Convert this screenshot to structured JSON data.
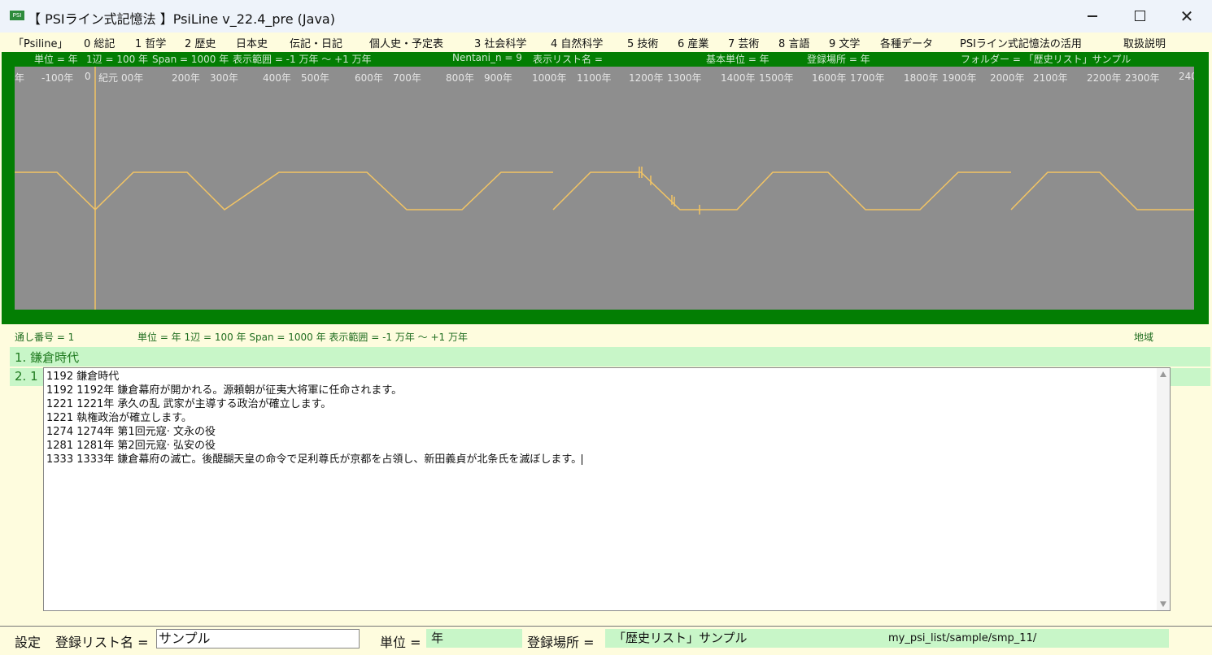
{
  "window": {
    "icon_text": "PSI",
    "title": "【 PSIライン式記憶法 】PsiLine v_22.4_pre (Java)"
  },
  "menu": [
    "「Psiline」",
    "0 総記",
    "1 哲学",
    "2 歴史",
    "日本史",
    "伝記・日記",
    "個人史・予定表",
    "3 社会科学",
    "4 自然科学",
    "5 技術",
    "6 産業",
    "7 芸術",
    "8 言語",
    "9 文学",
    "各種データ",
    "PSIライン式記憶法の活用",
    "取扱説明"
  ],
  "timeline": {
    "info": {
      "unit": "単位 = 年",
      "side": "1辺 = 100 年",
      "span": "Span = 1000 年",
      "range": "表示範囲 = -1 万年 〜 +1 万年",
      "nentani": "Nentani_n = 9",
      "list_name": "表示リスト名 =",
      "base_unit": "基本単位 = 年",
      "location": "登録場所 = 年",
      "folder": "フォルダー = 「歴史リスト」サンプル"
    },
    "ticks": [
      "年",
      "-100年",
      "0",
      "紀元",
      "00年",
      "200年",
      "300年",
      "400年",
      "500年",
      "600年",
      "700年",
      "800年",
      "900年",
      "1000年",
      "1100年",
      "1200年",
      "1300年",
      "1400年",
      "1500年",
      "1600年",
      "1700年",
      "1800年",
      "1900年",
      "2000年",
      "2100年",
      "2200年",
      "2300年",
      "240"
    ],
    "line_color": "#f2c464",
    "background_color": "#8e8e8e",
    "frame_color": "#037e03"
  },
  "status": {
    "serial": "通し番号 = 1",
    "detail": "単位 = 年  1辺 = 100 年  Span = 1000 年  表示範囲 = -1 万年 〜 +1 万年",
    "region": "地域"
  },
  "list": {
    "item1": "1. 鎌倉時代",
    "item2": "2. 1"
  },
  "editor": {
    "lines": [
      "1192  鎌倉時代",
      "1192  1192年 鎌倉幕府が開かれる。源頼朝が征夷大将軍に任命されます。",
      "1221  1221年 承久の乱 武家が主導する政治が確立します。",
      "1221  執権政治が確立します。",
      "1274  1274年 第1回元寇· 文永の役",
      "1281  1281年 第2回元寇· 弘安の役",
      "1333  1333年 鎌倉幕府の滅亡。後醍醐天皇の命令で足利尊氏が京都を占領し、新田義貞が北条氏を滅ぼします。"
    ]
  },
  "bottom": {
    "settings": "設定",
    "list_name_label": "登録リスト名 =",
    "list_name_value": "サンプル",
    "unit_label": "単位 =",
    "unit_value": "年",
    "location_label": "登録場所 =",
    "location_value": "「歴史リスト」サンプル",
    "path": "my_psi_list/sample/smp_11/"
  }
}
